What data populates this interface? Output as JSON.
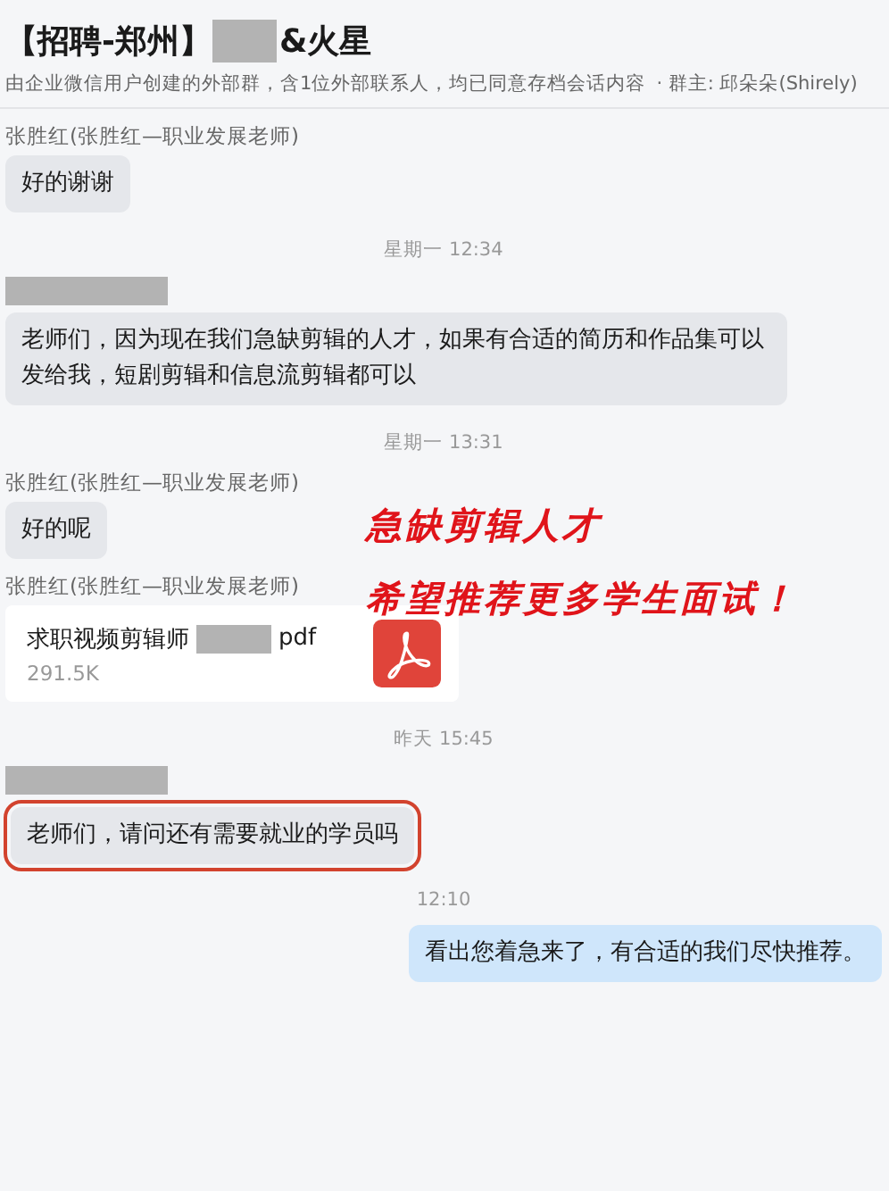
{
  "header": {
    "title_prefix": "【招聘-郑州】",
    "title_suffix": "&火星",
    "subtitle": "由企业微信用户创建的外部群，含1位外部联系人，均已同意存档会话内容",
    "owner": "· 群主: 邱朵朵(Shirely)"
  },
  "messages": [
    {
      "kind": "sender",
      "name": "张胜红(张胜红—职业发展老师)"
    },
    {
      "kind": "bubble",
      "text": "好的谢谢",
      "highlighted": false
    },
    {
      "kind": "time",
      "text": "星期一 12:34"
    },
    {
      "kind": "redacted-sender"
    },
    {
      "kind": "bubble",
      "text": "老师们，因为现在我们急缺剪辑的人才，如果有合适的简历和作品集可以发给我，短剧剪辑和信息流剪辑都可以",
      "highlighted": false
    },
    {
      "kind": "time",
      "text": "星期一 13:31"
    },
    {
      "kind": "sender",
      "name": "张胜红(张胜红—职业发展老师)"
    },
    {
      "kind": "bubble",
      "text": "好的呢",
      "highlighted": false
    },
    {
      "kind": "sender",
      "name": "张胜红(张胜红—职业发展老师)"
    },
    {
      "kind": "file",
      "name_prefix": "求职视频剪辑师",
      "name_suffix": "pdf",
      "size": "291.5K"
    },
    {
      "kind": "time",
      "text": "昨天 15:45"
    },
    {
      "kind": "redacted-sender"
    },
    {
      "kind": "bubble",
      "text": "老师们，请问还有需要就业的学员吗",
      "highlighted": true
    },
    {
      "kind": "time",
      "text": "12:10"
    },
    {
      "kind": "outgoing",
      "text": "看出您着急来了，有合适的我们尽快推荐。"
    }
  ],
  "annotation": [
    "急缺剪辑人才",
    "希望推荐更多学生面试！"
  ]
}
